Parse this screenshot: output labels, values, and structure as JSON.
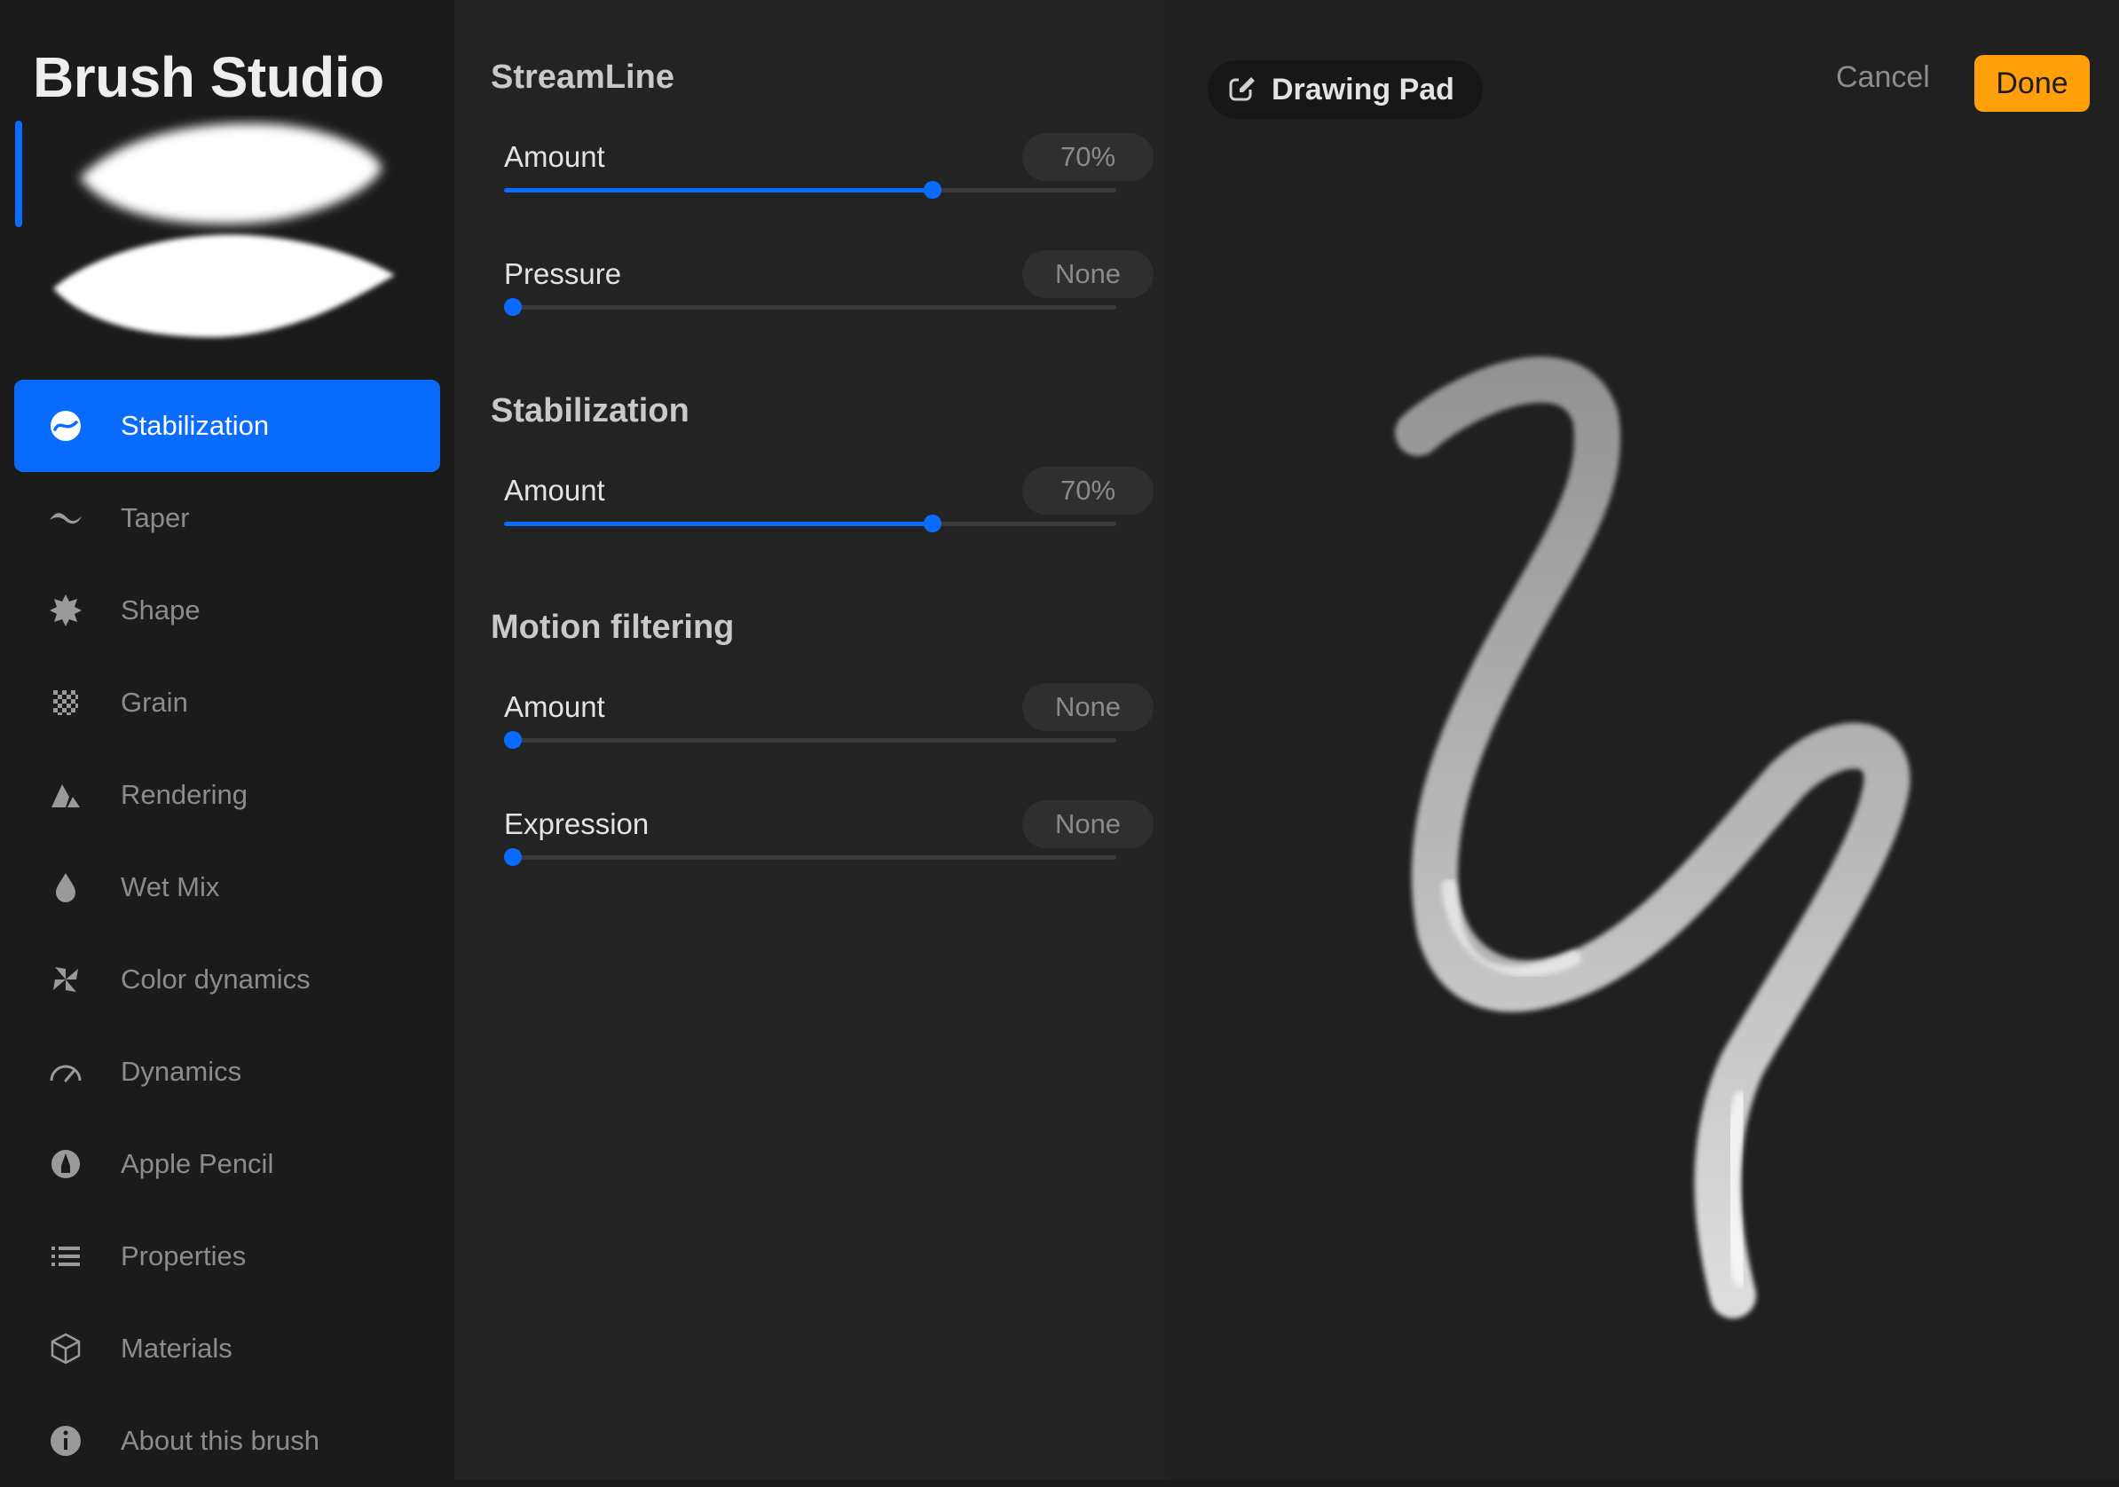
{
  "sidebar": {
    "title": "Brush Studio",
    "items": [
      {
        "label": "Stabilization",
        "icon": "stabilization-icon",
        "active": true
      },
      {
        "label": "Taper",
        "icon": "taper-icon"
      },
      {
        "label": "Shape",
        "icon": "shape-icon"
      },
      {
        "label": "Grain",
        "icon": "grain-icon"
      },
      {
        "label": "Rendering",
        "icon": "rendering-icon"
      },
      {
        "label": "Wet Mix",
        "icon": "wet-mix-icon"
      },
      {
        "label": "Color dynamics",
        "icon": "color-dynamics-icon"
      },
      {
        "label": "Dynamics",
        "icon": "dynamics-icon"
      },
      {
        "label": "Apple Pencil",
        "icon": "apple-pencil-icon"
      },
      {
        "label": "Properties",
        "icon": "properties-icon"
      },
      {
        "label": "Materials",
        "icon": "materials-icon"
      },
      {
        "label": "About this brush",
        "icon": "info-icon"
      }
    ]
  },
  "settings": {
    "streamline": {
      "title": "StreamLine",
      "amount": {
        "label": "Amount",
        "value": "70%",
        "level": 0.7
      },
      "pressure": {
        "label": "Pressure",
        "value": "None",
        "level": 0
      }
    },
    "stabilization": {
      "title": "Stabilization",
      "amount": {
        "label": "Amount",
        "value": "70%",
        "level": 0.7
      }
    },
    "motion_filtering": {
      "title": "Motion filtering",
      "amount": {
        "label": "Amount",
        "value": "None",
        "level": 0
      },
      "expression": {
        "label": "Expression",
        "value": "None",
        "level": 0
      }
    }
  },
  "pad": {
    "label": "Drawing Pad",
    "cancel": "Cancel",
    "done": "Done"
  },
  "colors": {
    "accent": "#0a6cff",
    "done": "#ff9f0a"
  }
}
